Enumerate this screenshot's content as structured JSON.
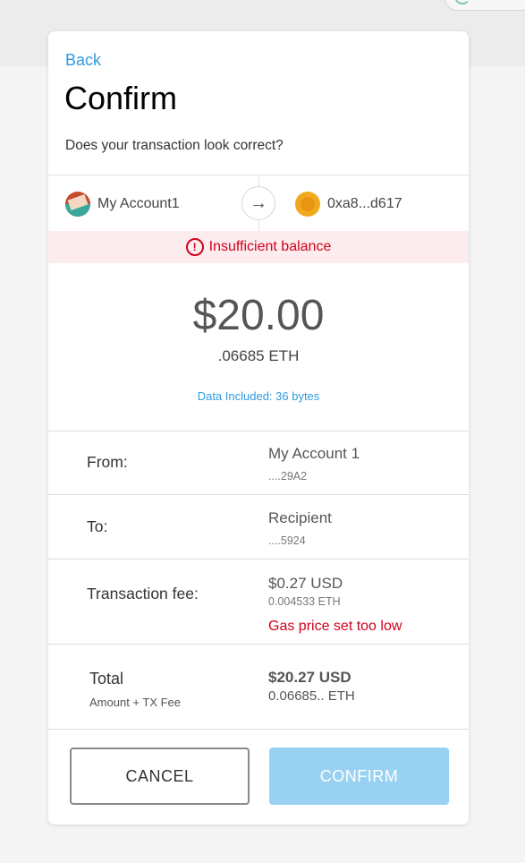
{
  "header": {
    "back_label": "Back",
    "title": "Confirm",
    "subtitle": "Does your transaction look correct?"
  },
  "accounts": {
    "from_name": "My Account1",
    "to_name": "0xa8...d617",
    "arrow_icon": "arrow-right-icon"
  },
  "error": {
    "icon": "warning-icon",
    "glyph": "!",
    "message": "Insufficient balance"
  },
  "amount": {
    "usd": "$20.00",
    "eth": ".06685 ETH",
    "data_included": "Data Included: 36 bytes"
  },
  "details": {
    "from": {
      "label": "From:",
      "name": "My Account 1",
      "address": "....29A2"
    },
    "to": {
      "label": "To:",
      "name": "Recipient",
      "address": "....5924"
    },
    "fee": {
      "label": "Transaction fee:",
      "usd": "$0.27 USD",
      "eth": "0.004533 ETH",
      "warning": "Gas price set too low"
    },
    "total": {
      "label": "Total",
      "sublabel": "Amount + TX Fee",
      "usd": "$20.27 USD",
      "eth": "0.06685.. ETH"
    }
  },
  "buttons": {
    "cancel": "CANCEL",
    "confirm": "CONFIRM"
  },
  "colors": {
    "accent": "#2f9ae0",
    "error": "#d0021b",
    "confirm_disabled": "#98d1f1"
  }
}
